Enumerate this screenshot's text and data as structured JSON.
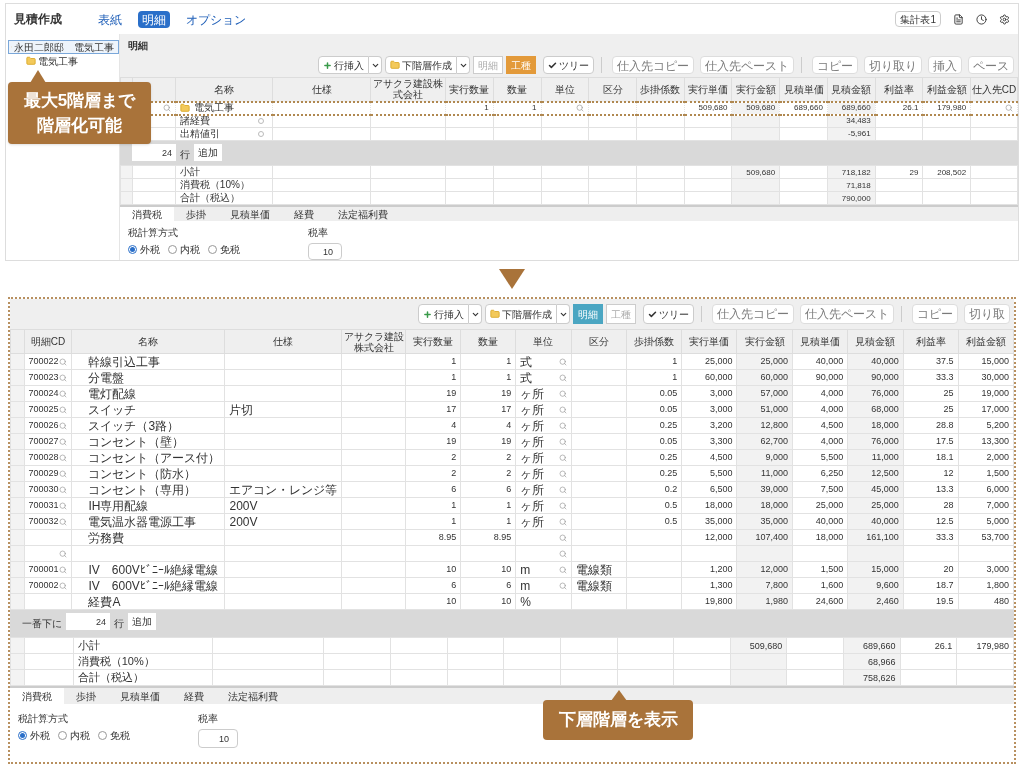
{
  "top": {
    "title": "見積作成",
    "tabs": [
      {
        "label": "表紙",
        "selected": false
      },
      {
        "label": "明細",
        "selected": true
      },
      {
        "label": "オプション",
        "selected": false
      }
    ],
    "summary_button": "集計表1",
    "tree": [
      {
        "label": "永田二郎邸　電気工事",
        "selected": true,
        "children": [
          {
            "label": "電気工事",
            "selected": false
          }
        ]
      }
    ],
    "section_title": "明細",
    "toolbar": [
      {
        "kind": "insert",
        "label": "行挿入"
      },
      {
        "kind": "subgroup",
        "label": "下階層作成"
      },
      {
        "kind": "view-detail",
        "label": "明細",
        "selected": false
      },
      {
        "kind": "view-trade",
        "label": "工種",
        "selected": true
      },
      {
        "kind": "tree",
        "label": "ツリー",
        "checked": true
      },
      {
        "kind": "supplier-action",
        "label": "仕入先コピー",
        "disabled": true
      },
      {
        "kind": "supplier-action",
        "label": "仕入先ペースト",
        "disabled": true
      },
      {
        "kind": "edit-action",
        "label": "コピー",
        "disabled": true
      },
      {
        "kind": "edit-action",
        "label": "切り取り",
        "disabled": true
      },
      {
        "kind": "edit-action",
        "label": "挿入",
        "disabled": true
      },
      {
        "kind": "edit-action",
        "label": "ペース",
        "disabled": true
      }
    ],
    "table": {
      "columns": [
        "名称",
        "仕様",
        "アサクラ建設株式会社",
        "実行数量",
        "数量",
        "単位",
        "区分",
        "歩掛係数",
        "実行単価",
        "実行金額",
        "見積単価",
        "見積金額",
        "利益率",
        "利益金額",
        "仕入先CD"
      ],
      "rows": [
        {
          "kind": "group",
          "cd_lookup": true,
          "unit_lookup": true,
          "supplier_lookup": true,
          "cells": [
            "電気工事",
            null,
            null,
            "1",
            "1",
            null,
            null,
            null,
            "509,680",
            "509,680",
            "689,660",
            "689,660",
            "26.1",
            "179,980",
            null
          ]
        },
        {
          "kind": "expense",
          "cd_lookup": false,
          "unit_lookup": false,
          "supplier_lookup": false,
          "cells": [
            "諸経費",
            null,
            null,
            null,
            null,
            null,
            null,
            null,
            null,
            null,
            null,
            "34,483",
            null,
            null,
            null
          ]
        },
        {
          "kind": "expense",
          "cd_lookup": false,
          "unit_lookup": false,
          "supplier_lookup": false,
          "cells": [
            "出精値引",
            null,
            null,
            null,
            null,
            null,
            null,
            null,
            null,
            null,
            null,
            "-5,961",
            null,
            null,
            null
          ]
        }
      ]
    },
    "add_row": {
      "count": "24",
      "unit": "行",
      "button": "追加"
    },
    "totals": [
      {
        "cells": [
          "小計",
          null,
          null,
          null,
          null,
          null,
          null,
          null,
          null,
          "509,680",
          null,
          "718,182",
          "29",
          "208,502",
          null
        ]
      },
      {
        "cells": [
          "消費税（10%）",
          null,
          null,
          null,
          null,
          null,
          null,
          null,
          null,
          null,
          null,
          "71,818",
          null,
          null,
          null
        ]
      },
      {
        "cells": [
          "合計（税込）",
          null,
          null,
          null,
          null,
          null,
          null,
          null,
          null,
          null,
          null,
          "790,000",
          null,
          null,
          null
        ]
      }
    ],
    "tabs_bottom": [
      {
        "label": "消費税",
        "selected": true
      },
      {
        "label": "歩掛",
        "selected": false
      },
      {
        "label": "見積単価",
        "selected": false
      },
      {
        "label": "経費",
        "selected": false
      },
      {
        "label": "法定福利費",
        "selected": false
      }
    ],
    "tax": {
      "method_label": "税計算方式",
      "options": [
        {
          "label": "外税",
          "selected": true
        },
        {
          "label": "内税",
          "selected": false
        },
        {
          "label": "免税",
          "selected": false
        }
      ],
      "rate_label": "税率",
      "rate": "10"
    },
    "callout": "最大5階層まで階層化可能"
  },
  "detail": {
    "toolbar": [
      {
        "kind": "insert",
        "label": "行挿入"
      },
      {
        "kind": "subgroup",
        "label": "下階層作成"
      },
      {
        "kind": "view-detail",
        "label": "明細",
        "selected": true
      },
      {
        "kind": "view-trade",
        "label": "工種",
        "selected": false
      },
      {
        "kind": "tree",
        "label": "ツリー",
        "checked": true
      },
      {
        "kind": "supplier-action",
        "label": "仕入先コピー",
        "disabled": true
      },
      {
        "kind": "supplier-action",
        "label": "仕入先ペースト",
        "disabled": true
      },
      {
        "kind": "edit-action",
        "label": "コピー",
        "disabled": true
      },
      {
        "kind": "edit-action",
        "label": "切り取",
        "disabled": true
      }
    ],
    "table": {
      "cd_header": "明細CD",
      "columns": [
        "名称",
        "仕様",
        "アサクラ建設株式会社",
        "実行数量",
        "数量",
        "単位",
        "区分",
        "歩掛係数",
        "実行単価",
        "実行金額",
        "見積単価",
        "見積金額",
        "利益率",
        "利益金額"
      ],
      "rows": [
        {
          "kind": "item",
          "cd": "700022",
          "cd_lookup": true,
          "unit_lookup": true,
          "cells": [
            "幹線引込工事",
            null,
            null,
            "1",
            "1",
            "式",
            null,
            "1",
            "25,000",
            "25,000",
            "40,000",
            "40,000",
            "37.5",
            "15,000"
          ]
        },
        {
          "kind": "item",
          "cd": "700023",
          "cd_lookup": true,
          "unit_lookup": true,
          "cells": [
            "分電盤",
            null,
            null,
            "1",
            "1",
            "式",
            null,
            "1",
            "60,000",
            "60,000",
            "90,000",
            "90,000",
            "33.3",
            "30,000"
          ]
        },
        {
          "kind": "item",
          "cd": "700024",
          "cd_lookup": true,
          "unit_lookup": true,
          "cells": [
            "電灯配線",
            null,
            null,
            "19",
            "19",
            "ヶ所",
            null,
            "0.05",
            "3,000",
            "57,000",
            "4,000",
            "76,000",
            "25",
            "19,000"
          ]
        },
        {
          "kind": "item",
          "cd": "700025",
          "cd_lookup": true,
          "unit_lookup": true,
          "cells": [
            "スイッチ",
            "片切",
            null,
            "17",
            "17",
            "ヶ所",
            null,
            "0.05",
            "3,000",
            "51,000",
            "4,000",
            "68,000",
            "25",
            "17,000"
          ]
        },
        {
          "kind": "item",
          "cd": "700026",
          "cd_lookup": true,
          "unit_lookup": true,
          "cells": [
            "スイッチ（3路）",
            null,
            null,
            "4",
            "4",
            "ヶ所",
            null,
            "0.25",
            "3,200",
            "12,800",
            "4,500",
            "18,000",
            "28.8",
            "5,200"
          ]
        },
        {
          "kind": "item",
          "cd": "700027",
          "cd_lookup": true,
          "unit_lookup": true,
          "cells": [
            "コンセント（壁）",
            null,
            null,
            "19",
            "19",
            "ヶ所",
            null,
            "0.05",
            "3,300",
            "62,700",
            "4,000",
            "76,000",
            "17.5",
            "13,300"
          ]
        },
        {
          "kind": "item",
          "cd": "700028",
          "cd_lookup": true,
          "unit_lookup": true,
          "cells": [
            "コンセント（アース付）",
            null,
            null,
            "2",
            "2",
            "ヶ所",
            null,
            "0.25",
            "4,500",
            "9,000",
            "5,500",
            "11,000",
            "18.1",
            "2,000"
          ]
        },
        {
          "kind": "item",
          "cd": "700029",
          "cd_lookup": true,
          "unit_lookup": true,
          "cells": [
            "コンセント（防水）",
            null,
            null,
            "2",
            "2",
            "ヶ所",
            null,
            "0.25",
            "5,500",
            "11,000",
            "6,250",
            "12,500",
            "12",
            "1,500"
          ]
        },
        {
          "kind": "item",
          "cd": "700030",
          "cd_lookup": true,
          "unit_lookup": true,
          "cells": [
            "コンセント（専用）",
            "エアコン・レンジ等",
            null,
            "6",
            "6",
            "ヶ所",
            null,
            "0.2",
            "6,500",
            "39,000",
            "7,500",
            "45,000",
            "13.3",
            "6,000"
          ]
        },
        {
          "kind": "item",
          "cd": "700031",
          "cd_lookup": true,
          "unit_lookup": true,
          "cells": [
            "IH専用配線",
            "200V",
            null,
            "1",
            "1",
            "ヶ所",
            null,
            "0.5",
            "18,000",
            "18,000",
            "25,000",
            "25,000",
            "28",
            "7,000"
          ]
        },
        {
          "kind": "item",
          "cd": "700032",
          "cd_lookup": true,
          "unit_lookup": true,
          "cells": [
            "電気温水器電源工事",
            "200V",
            null,
            "1",
            "1",
            "ヶ所",
            null,
            "0.5",
            "35,000",
            "35,000",
            "40,000",
            "40,000",
            "12.5",
            "5,000"
          ]
        },
        {
          "kind": "item",
          "cd_lookup": false,
          "unit_lookup": true,
          "cells": [
            "労務費",
            null,
            null,
            "8.95",
            "8.95",
            null,
            null,
            null,
            "12,000",
            "107,400",
            "18,000",
            "161,100",
            "33.3",
            "53,700"
          ]
        },
        {
          "kind": "item",
          "cd_lookup": true,
          "unit_lookup": true,
          "cells": [
            null,
            null,
            null,
            null,
            null,
            null,
            null,
            null,
            null,
            null,
            null,
            null,
            null,
            null
          ]
        },
        {
          "kind": "item",
          "cd": "700001",
          "cd_lookup": true,
          "unit_lookup": true,
          "cells": [
            "IV　600Vﾋﾞﾆｰﾙ絶縁電線",
            null,
            null,
            "10",
            "10",
            "m",
            "電線類",
            null,
            "1,200",
            "12,000",
            "1,500",
            "15,000",
            "20",
            "3,000"
          ]
        },
        {
          "kind": "item",
          "cd": "700002",
          "cd_lookup": true,
          "unit_lookup": true,
          "cells": [
            "IV　600Vﾋﾞﾆｰﾙ絶縁電線",
            null,
            null,
            "6",
            "6",
            "m",
            "電線類",
            null,
            "1,300",
            "7,800",
            "1,600",
            "9,600",
            "18.7",
            "1,800"
          ]
        },
        {
          "kind": "item",
          "cd_lookup": false,
          "unit_lookup": false,
          "cells": [
            "経費A",
            null,
            null,
            "10",
            "10",
            "%",
            null,
            null,
            "19,800",
            "1,980",
            "24,600",
            "2,460",
            "19.5",
            "480"
          ]
        }
      ]
    },
    "add_row": {
      "label": "一番下に",
      "count": "24",
      "unit": "行",
      "button": "追加"
    },
    "totals": [
      {
        "cells": [
          "小計",
          null,
          null,
          null,
          null,
          null,
          null,
          null,
          null,
          "509,680",
          null,
          "689,660",
          "26.1",
          "179,980"
        ]
      },
      {
        "cells": [
          "消費税（10%）",
          null,
          null,
          null,
          null,
          null,
          null,
          null,
          null,
          null,
          null,
          "68,966",
          null,
          null
        ]
      },
      {
        "cells": [
          "合計（税込）",
          null,
          null,
          null,
          null,
          null,
          null,
          null,
          null,
          null,
          null,
          "758,626",
          null,
          null
        ]
      }
    ],
    "tabs_bottom": [
      {
        "label": "消費税",
        "selected": true
      },
      {
        "label": "歩掛",
        "selected": false
      },
      {
        "label": "見積単価",
        "selected": false
      },
      {
        "label": "経費",
        "selected": false
      },
      {
        "label": "法定福利費",
        "selected": false
      }
    ],
    "tax": {
      "method_label": "税計算方式",
      "options": [
        {
          "label": "外税",
          "selected": true
        },
        {
          "label": "内税",
          "selected": false
        },
        {
          "label": "免税",
          "selected": false
        }
      ],
      "rate_label": "税率",
      "rate": "10"
    },
    "callout": "下層階層を表示"
  }
}
